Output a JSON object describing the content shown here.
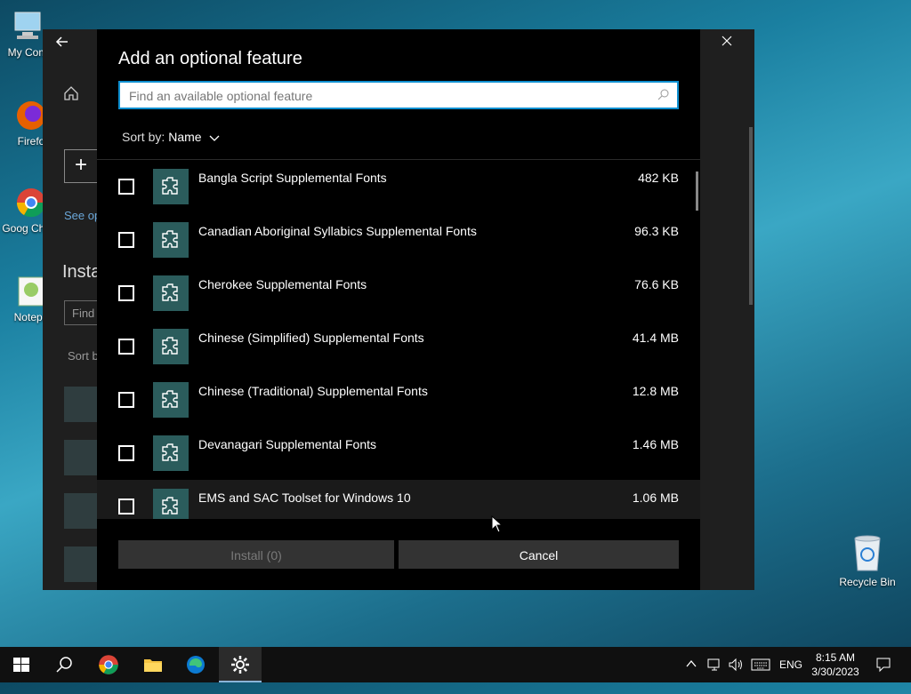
{
  "desktop": {
    "icons": [
      {
        "label": "My Com"
      },
      {
        "label": "Firefo"
      },
      {
        "label": "Goog Chron"
      },
      {
        "label": "Notepa"
      }
    ],
    "recycle_bin": "Recycle Bin"
  },
  "settings_window": {
    "see_link": "See op",
    "installed_heading": "Insta",
    "find_placeholder": "Find",
    "sort_label": "Sort b"
  },
  "dialog": {
    "title": "Add an optional feature",
    "search_placeholder": "Find an available optional feature",
    "sort_label": "Sort by:",
    "sort_value": "Name",
    "features": [
      {
        "name": "Bangla Script Supplemental Fonts",
        "size": "482 KB"
      },
      {
        "name": "Canadian Aboriginal Syllabics Supplemental Fonts",
        "size": "96.3 KB"
      },
      {
        "name": "Cherokee Supplemental Fonts",
        "size": "76.6 KB"
      },
      {
        "name": "Chinese (Simplified) Supplemental Fonts",
        "size": "41.4 MB"
      },
      {
        "name": "Chinese (Traditional) Supplemental Fonts",
        "size": "12.8 MB"
      },
      {
        "name": "Devanagari Supplemental Fonts",
        "size": "1.46 MB"
      },
      {
        "name": "EMS and SAC Toolset for Windows 10",
        "size": "1.06 MB"
      }
    ],
    "install_label": "Install (0)",
    "cancel_label": "Cancel"
  },
  "taskbar": {
    "language": "ENG",
    "time": "8:15 AM",
    "date": "3/30/2023"
  },
  "colors": {
    "accent": "#0e8fd0",
    "feature_icon_bg": "#2b5c5c"
  }
}
